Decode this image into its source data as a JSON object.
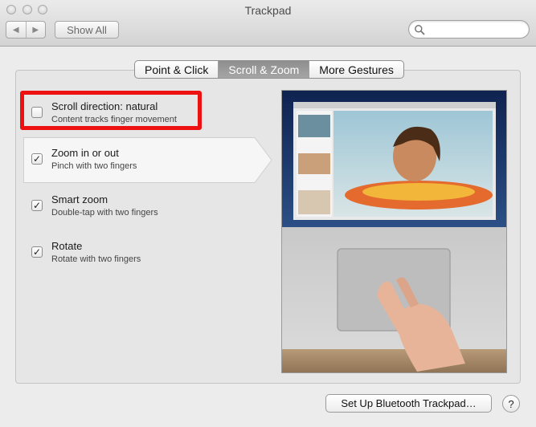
{
  "window": {
    "title": "Trackpad"
  },
  "toolbar": {
    "back_glyph": "◀",
    "forward_glyph": "▶",
    "show_all_label": "Show All",
    "search_placeholder": "",
    "search_value": ""
  },
  "tabs": [
    {
      "label": "Point & Click",
      "active": false
    },
    {
      "label": "Scroll & Zoom",
      "active": true
    },
    {
      "label": "More Gestures",
      "active": false
    }
  ],
  "options": [
    {
      "title": "Scroll direction: natural",
      "subtitle": "Content tracks finger movement",
      "checked": false,
      "check_glyph": ""
    },
    {
      "title": "Zoom in or out",
      "subtitle": "Pinch with two fingers",
      "checked": true,
      "check_glyph": "✓"
    },
    {
      "title": "Smart zoom",
      "subtitle": "Double-tap with two fingers",
      "checked": true,
      "check_glyph": "✓"
    },
    {
      "title": "Rotate",
      "subtitle": "Rotate with two fingers",
      "checked": true,
      "check_glyph": "✓"
    }
  ],
  "footer": {
    "bluetooth_label": "Set Up Bluetooth Trackpad…",
    "help_label": "?"
  },
  "colors": {
    "highlight": "#ee1111",
    "active_tab": "#8e8e8e"
  }
}
